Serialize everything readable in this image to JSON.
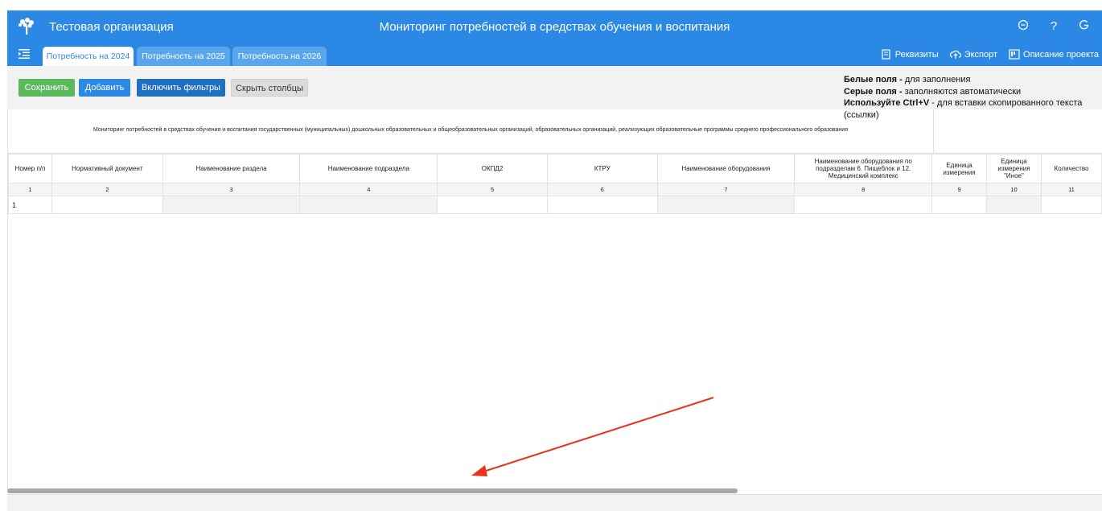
{
  "header": {
    "org_name": "Тестовая организация",
    "app_title": "Мониторинг потребностей в средствах обучения и воспитания",
    "icons": [
      "user-circle-icon",
      "help-icon",
      "logout-icon"
    ],
    "brand_color": "#2b88e4"
  },
  "tabs": [
    {
      "label": "Потребность на 2024",
      "active": true
    },
    {
      "label": "Потребность на 2025",
      "active": false
    },
    {
      "label": "Потребность на 2026",
      "active": false
    }
  ],
  "header_actions": {
    "requisites": "Реквизиты",
    "export": "Экспорт",
    "project_description": "Описание проекта"
  },
  "toolbar": {
    "save": "Сохранить",
    "add": "Добавить",
    "enable_filters": "Включить фильтры",
    "hide_columns": "Скрыть столбцы"
  },
  "legend": {
    "white_bold": "Белые поля -",
    "white_text": " для заполнения",
    "gray_bold": "Серые поля -",
    "gray_text": " заполняются автоматически",
    "paste_bold": "Используйте Ctrl+V",
    "paste_text": " - для вставки скопированного текста (ссылки)"
  },
  "table": {
    "caption": "Мониторинг потребностей в средствах обучения и воспитания государственных (муниципальных) дошкольных образовательных и общеобразовательных организаций, образовательных организаций, реализующих образовательные программы среднего профессионального образования",
    "columns": [
      "Номер п/п",
      "Нормативный документ",
      "Наименование раздела",
      "Наименование подраздела",
      "ОКПД2",
      "КТРУ",
      "Наименование оборудования",
      "Наименование оборудования по подразделам 6. Пищеблок и 12. Медицинский комплекс",
      "Единица измерения",
      "Единица измерения \"Иное\"",
      "Количество"
    ],
    "numbers": [
      "1",
      "2",
      "3",
      "4",
      "5",
      "6",
      "7",
      "8",
      "9",
      "10",
      "11"
    ],
    "rows": [
      {
        "num": "1"
      }
    ]
  }
}
